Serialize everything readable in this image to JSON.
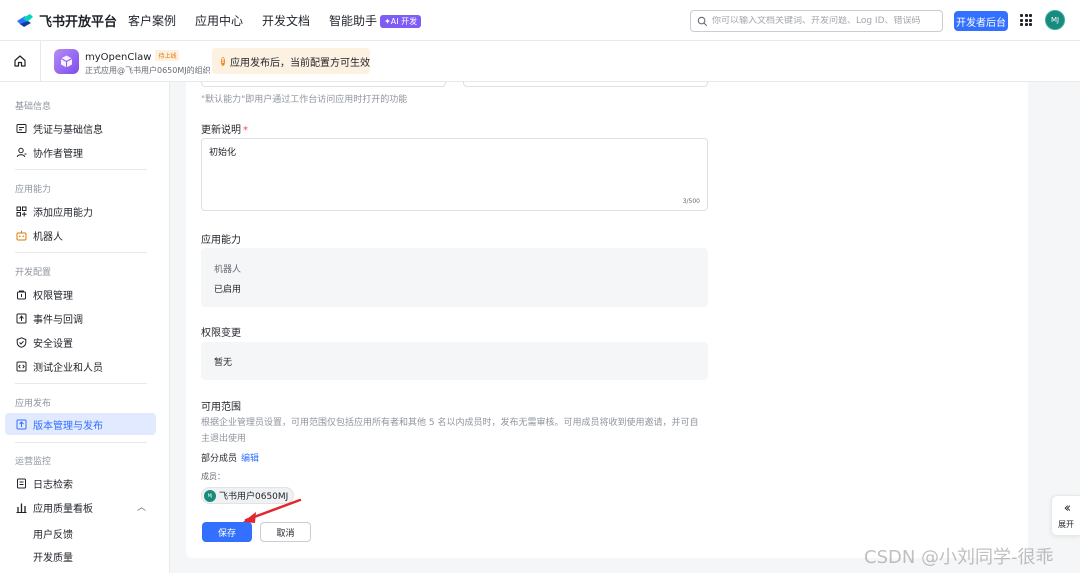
{
  "topnav": {
    "brand": "飞书开放平台",
    "items": [
      "客户案例",
      "应用中心",
      "开发文档",
      "智能助手"
    ],
    "ai_badge": "✦AI 开发",
    "search_placeholder": "你可以输入文档关键词、开发问题、Log ID、错误码",
    "dev_button": "开发者后台",
    "avatar": "MJ"
  },
  "app_header": {
    "app_name": "myOpenClaw",
    "status_tag": "待上线",
    "app_sub": "正式应用@飞书用户0650MJ的组织",
    "notice": "应用发布后，当前配置方可生效"
  },
  "sidebar": {
    "groups": {
      "basic": "基础信息",
      "capability": "应用能力",
      "dev_config": "开发配置",
      "release": "应用发布",
      "ops": "运营监控"
    },
    "items": {
      "credentials": "凭证与基础信息",
      "collaborators": "协作者管理",
      "add_capability": "添加应用能力",
      "bot": "机器人",
      "permissions": "权限管理",
      "events": "事件与回调",
      "security": "安全设置",
      "test_org": "测试企业和人员",
      "version": "版本管理与发布",
      "logs": "日志检索",
      "quality": "应用质量看板",
      "feedback": "用户反馈",
      "dev_quality": "开发质量"
    }
  },
  "form": {
    "default_capability_desc": "\"默认能力\"即用户通过工作台访问应用时打开的功能",
    "update_notes_label": "更新说明",
    "update_notes_value": "初始化",
    "char_count": "3/500",
    "capability_label": "应用能力",
    "capability_name": "机器人",
    "capability_status": "已启用",
    "permission_label": "权限变更",
    "permission_value": "暂无",
    "scope_label": "可用范围",
    "scope_desc": "根据企业管理员设置，可用范围仅包括应用所有者和其他 5 名以内成员时，发布无需审核。可用成员将收到使用邀请，并可自主退出使用",
    "partial_members": "部分成员",
    "edit": "编辑",
    "members_label": "成员：",
    "member_avatar": "MJ",
    "member_name": "飞书用户0650MJ",
    "save": "保存",
    "cancel": "取消"
  },
  "expand_label": "展开",
  "watermark": "CSDN @小刘同学-很乖",
  "colors": {
    "primary": "#3370ff",
    "required": "#f54a45",
    "notice_bg": "#fdf1e1",
    "active_bg": "#e1eaff"
  }
}
